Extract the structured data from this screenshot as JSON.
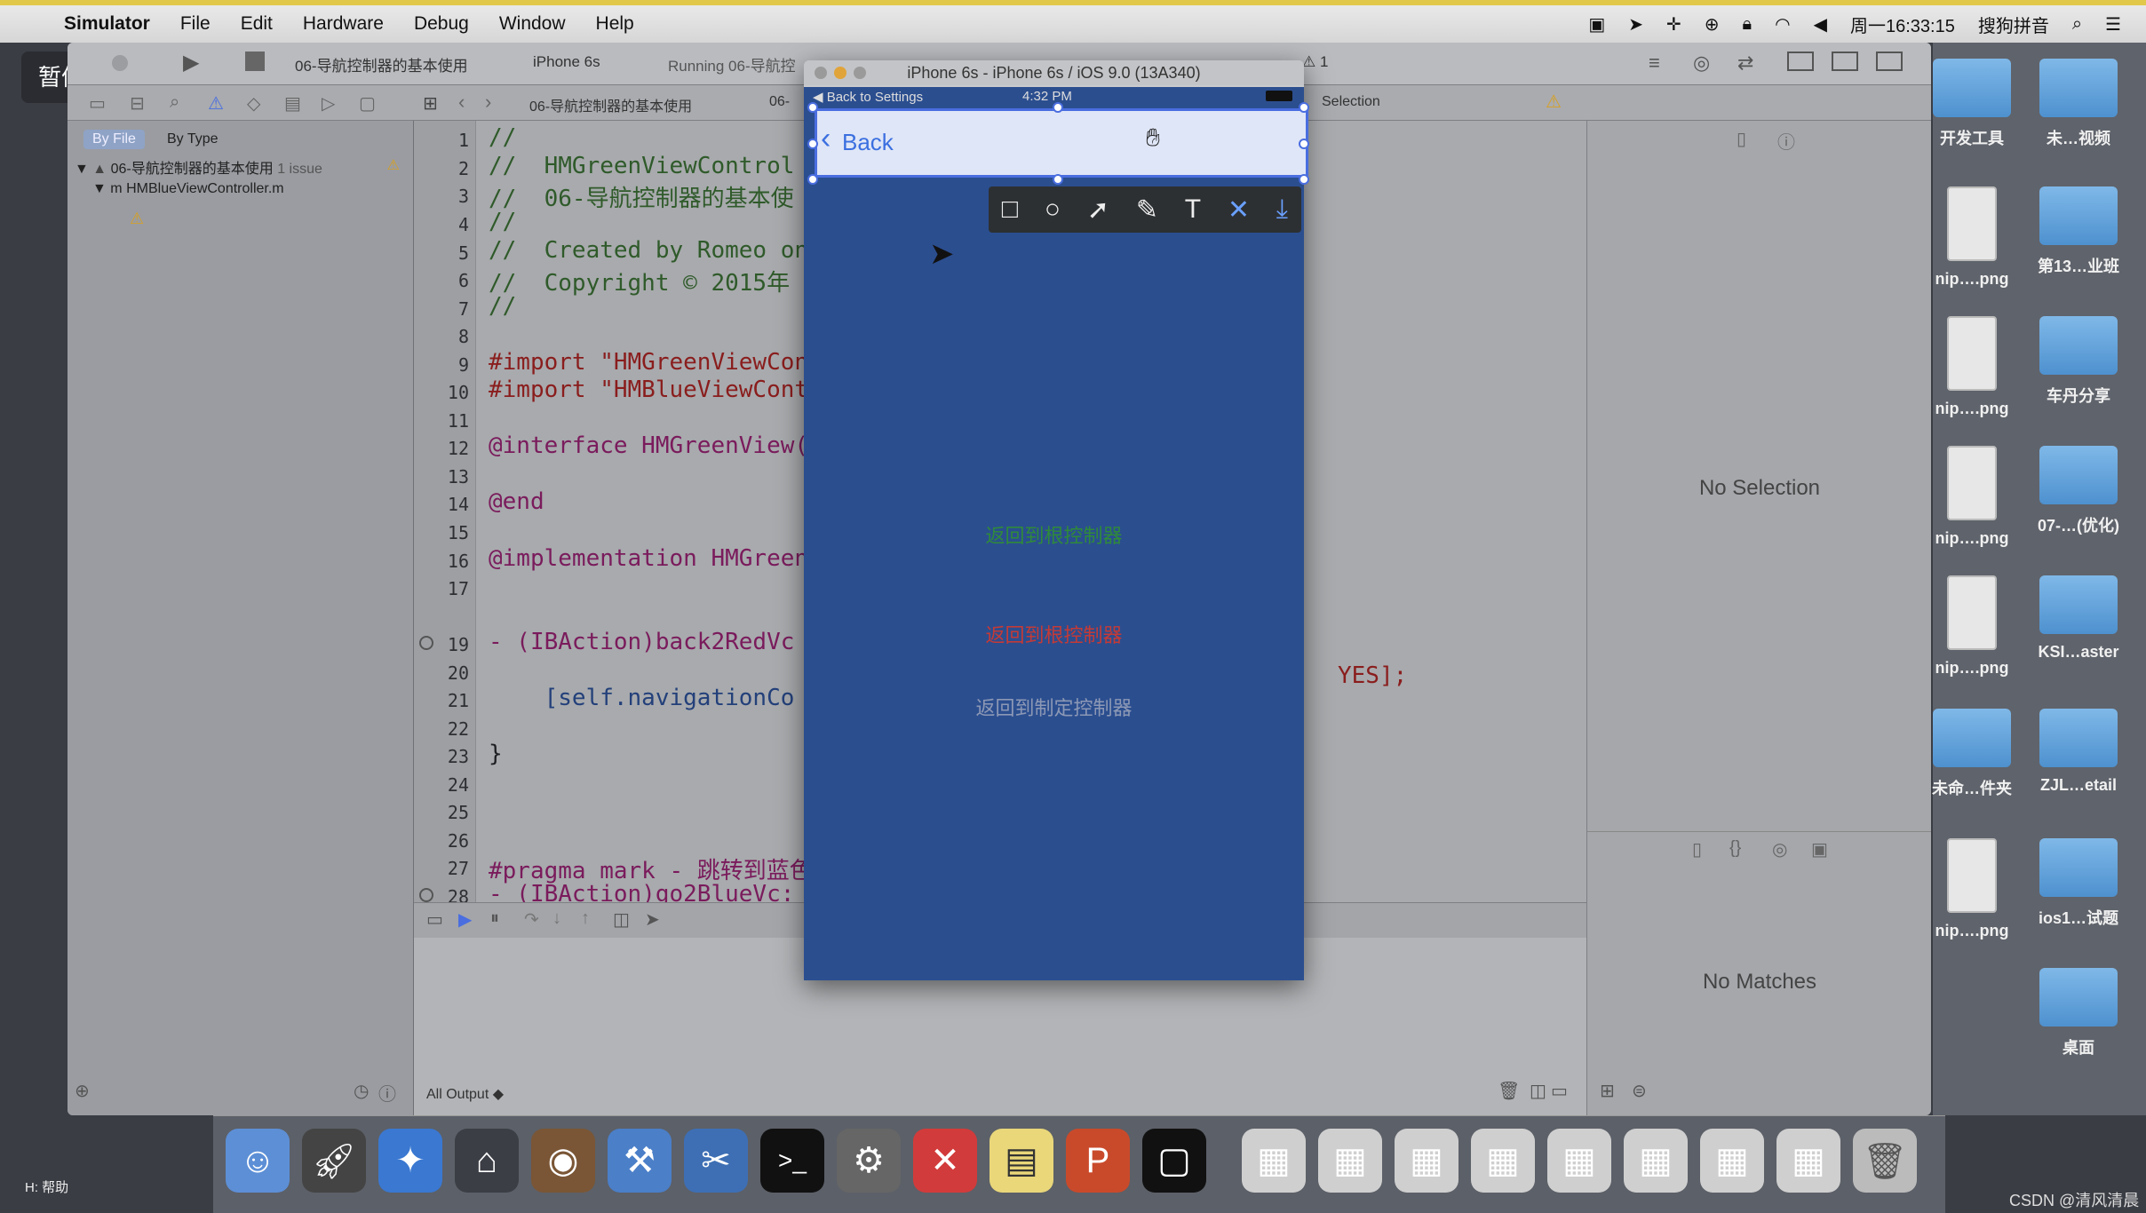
{
  "menubar": {
    "apple": "",
    "app": "Simulator",
    "items": [
      "File",
      "Edit",
      "Hardware",
      "Debug",
      "Window",
      "Help"
    ],
    "clock": "周一16:33:15",
    "input_method": "搜狗拼音"
  },
  "pause_badge": "暂停",
  "xcode": {
    "scheme_project": "06-导航控制器的基本使用",
    "scheme_device": "iPhone 6s",
    "running_status": "Running 06-导航控",
    "warning_count": "1",
    "jumpbar_project": "06-导航控制器的基本使用",
    "jumpbar_folder": "06-",
    "jumpbar_right": "Selection",
    "navigator": {
      "filter_tabs": [
        "By File",
        "By Type"
      ],
      "project_row": "06-导航控制器的基本使用",
      "project_issue": "1 issue",
      "file_row": "HMBlueViewController.m"
    },
    "code_lines": [
      {
        "n": "1",
        "text": "//",
        "type": "cm"
      },
      {
        "n": "2",
        "text": "//  HMGreenViewControl",
        "type": "cm"
      },
      {
        "n": "3",
        "text": "//  06-导航控制器的基本使",
        "type": "cm"
      },
      {
        "n": "4",
        "text": "//",
        "type": "cm"
      },
      {
        "n": "5",
        "text": "//  Created by Romeo on",
        "type": "cm"
      },
      {
        "n": "6",
        "text": "//  Copyright © 2015年",
        "type": "cm"
      },
      {
        "n": "7",
        "text": "//",
        "type": "cm"
      },
      {
        "n": "8",
        "text": "",
        "type": ""
      },
      {
        "n": "9",
        "text": "#import \"HMGreenViewCon",
        "type": "st"
      },
      {
        "n": "10",
        "text": "#import \"HMBlueViewCont",
        "type": "st"
      },
      {
        "n": "11",
        "text": "",
        "type": ""
      },
      {
        "n": "12",
        "text": "@interface HMGreenView(",
        "type": "kw"
      },
      {
        "n": "13",
        "text": "",
        "type": ""
      },
      {
        "n": "14",
        "text": "@end",
        "type": "kw"
      },
      {
        "n": "15",
        "text": "",
        "type": ""
      },
      {
        "n": "16",
        "text": "@implementation HMGreen",
        "type": "kw"
      },
      {
        "n": "17",
        "text": "",
        "type": ""
      },
      {
        "n": "19",
        "text": "- (IBAction)back2RedVc",
        "type": "kw"
      },
      {
        "n": "20",
        "text": "",
        "type": ""
      },
      {
        "n": "21",
        "text": "    [self.navigationCo",
        "type": "cls"
      },
      {
        "n": "22",
        "text": "",
        "type": ""
      },
      {
        "n": "23",
        "text": "}",
        "type": ""
      },
      {
        "n": "24",
        "text": "",
        "type": ""
      },
      {
        "n": "25",
        "text": "",
        "type": ""
      },
      {
        "n": "26",
        "text": "",
        "type": ""
      },
      {
        "n": "27",
        "text": "#pragma mark - 跳转到蓝色",
        "type": "kw"
      },
      {
        "n": "28",
        "text": "- (IBAction)go2BlueVc:",
        "type": "kw"
      }
    ],
    "code_tail_line21": "YES];",
    "console_filter": "All Output ◆",
    "inspector_top": "No Selection",
    "inspector_bottom": "No Matches"
  },
  "simulator": {
    "title": "iPhone 6s - iPhone 6s / iOS 9.0 (13A340)",
    "status_left": "◀ Back to Settings",
    "status_time": "4:32 PM",
    "back_label": "Back",
    "green_button": "返回到根控制器",
    "red_button": "返回到根控制器",
    "gray_button": "返回到制定控制器",
    "screen_color": "#2b4e8f"
  },
  "snip_tools": [
    "rectangle-tool",
    "ellipse-tool",
    "arrow-tool",
    "brush-tool",
    "text-tool",
    "close-tool",
    "download-tool"
  ],
  "desktop": [
    {
      "label": "开发工具",
      "kind": "folder"
    },
    {
      "label": "未…视频",
      "kind": "folder"
    },
    {
      "label": "nip….png",
      "kind": "file"
    },
    {
      "label": "第13…业班",
      "kind": "folder"
    },
    {
      "label": "nip….png",
      "kind": "file"
    },
    {
      "label": "车丹分享",
      "kind": "folder"
    },
    {
      "label": "nip….png",
      "kind": "file"
    },
    {
      "label": "07-…(优化)",
      "kind": "folder"
    },
    {
      "label": "nip….png",
      "kind": "file"
    },
    {
      "label": "KSI…aster",
      "kind": "folder"
    },
    {
      "label": "未命…件夹",
      "kind": "folder"
    },
    {
      "label": "ZJL…etail",
      "kind": "folder"
    },
    {
      "label": "nip….png",
      "kind": "file"
    },
    {
      "label": "ios1…试题",
      "kind": "folder"
    },
    {
      "label": "桌面",
      "kind": "folder"
    }
  ],
  "bottom_left_hint": "H: 帮助",
  "watermark": "CSDN @清风清晨"
}
